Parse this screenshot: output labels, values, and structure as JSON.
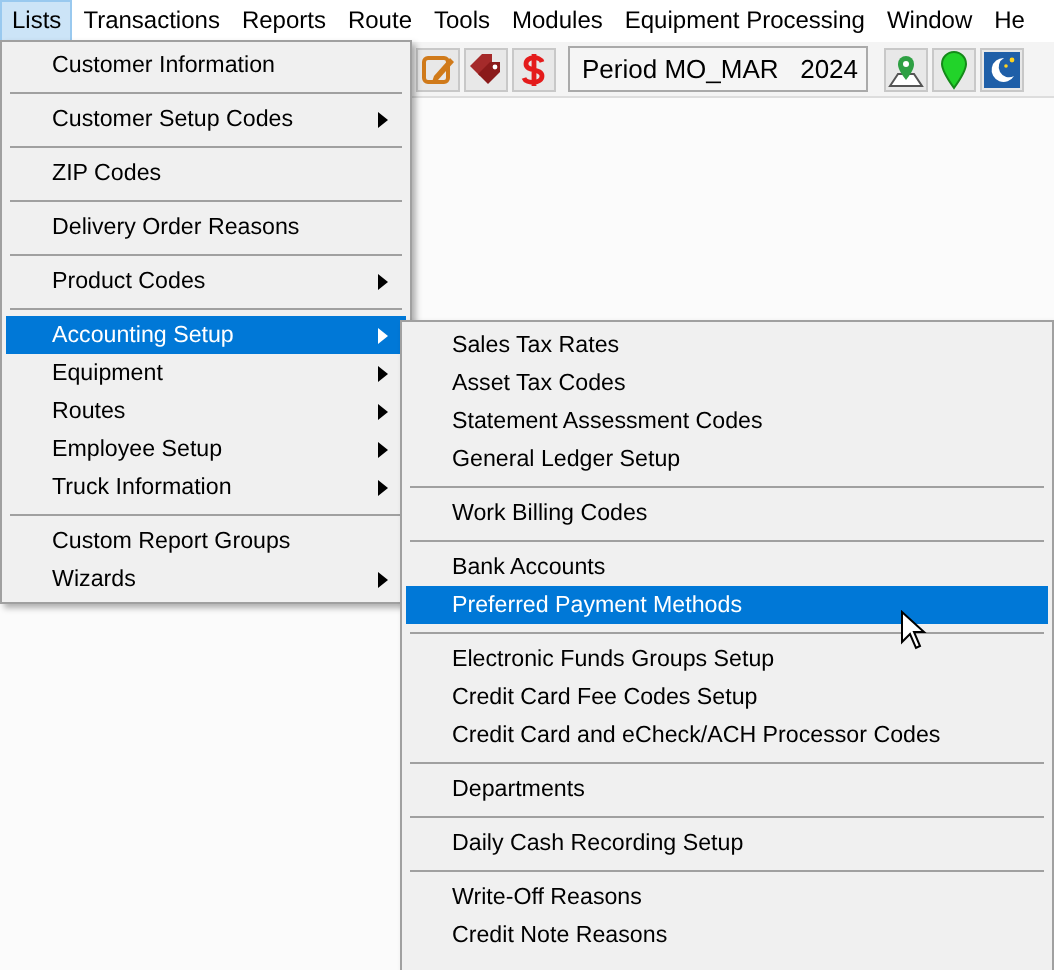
{
  "menubar": [
    {
      "label": "Lists",
      "selected": true
    },
    {
      "label": "Transactions",
      "selected": false
    },
    {
      "label": "Reports",
      "selected": false
    },
    {
      "label": "Route",
      "selected": false
    },
    {
      "label": "Tools",
      "selected": false
    },
    {
      "label": "Modules",
      "selected": false
    },
    {
      "label": "Equipment Processing",
      "selected": false
    },
    {
      "label": "Window",
      "selected": false
    },
    {
      "label": "He",
      "selected": false
    }
  ],
  "toolbar": {
    "period_button": "Period MO_MAR   2024"
  },
  "lists_menu": [
    {
      "kind": "item",
      "label": "Customer Information",
      "submenu": false,
      "selected": false
    },
    {
      "kind": "separator"
    },
    {
      "kind": "item",
      "label": "Customer Setup Codes",
      "submenu": true,
      "selected": false
    },
    {
      "kind": "separator"
    },
    {
      "kind": "item",
      "label": "ZIP Codes",
      "submenu": false,
      "selected": false
    },
    {
      "kind": "separator"
    },
    {
      "kind": "item",
      "label": "Delivery Order Reasons",
      "submenu": false,
      "selected": false
    },
    {
      "kind": "separator"
    },
    {
      "kind": "item",
      "label": "Product Codes",
      "submenu": true,
      "selected": false
    },
    {
      "kind": "separator"
    },
    {
      "kind": "item",
      "label": "Accounting Setup",
      "submenu": true,
      "selected": true
    },
    {
      "kind": "item",
      "label": "Equipment",
      "submenu": true,
      "selected": false
    },
    {
      "kind": "item",
      "label": "Routes",
      "submenu": true,
      "selected": false
    },
    {
      "kind": "item",
      "label": "Employee Setup",
      "submenu": true,
      "selected": false
    },
    {
      "kind": "item",
      "label": "Truck Information",
      "submenu": true,
      "selected": false
    },
    {
      "kind": "separator"
    },
    {
      "kind": "item",
      "label": "Custom Report Groups",
      "submenu": false,
      "selected": false
    },
    {
      "kind": "item",
      "label": "Wizards",
      "submenu": true,
      "selected": false
    }
  ],
  "accounting_submenu": [
    {
      "kind": "item",
      "label": "Sales Tax Rates",
      "selected": false
    },
    {
      "kind": "item",
      "label": "Asset Tax Codes",
      "selected": false
    },
    {
      "kind": "item",
      "label": "Statement Assessment Codes",
      "selected": false
    },
    {
      "kind": "item",
      "label": "General Ledger Setup",
      "selected": false
    },
    {
      "kind": "separator"
    },
    {
      "kind": "item",
      "label": "Work Billing Codes",
      "selected": false
    },
    {
      "kind": "separator"
    },
    {
      "kind": "item",
      "label": "Bank Accounts",
      "selected": false
    },
    {
      "kind": "item",
      "label": "Preferred Payment Methods",
      "selected": true
    },
    {
      "kind": "separator"
    },
    {
      "kind": "item",
      "label": "Electronic Funds Groups Setup",
      "selected": false
    },
    {
      "kind": "item",
      "label": "Credit Card Fee Codes Setup",
      "selected": false
    },
    {
      "kind": "item",
      "label": "Credit Card and eCheck/ACH Processor Codes",
      "selected": false
    },
    {
      "kind": "separator"
    },
    {
      "kind": "item",
      "label": "Departments",
      "selected": false
    },
    {
      "kind": "separator"
    },
    {
      "kind": "item",
      "label": "Daily Cash Recording Setup",
      "selected": false
    },
    {
      "kind": "separator"
    },
    {
      "kind": "item",
      "label": "Write-Off Reasons",
      "selected": false
    },
    {
      "kind": "item",
      "label": "Credit Note Reasons",
      "selected": false
    }
  ]
}
